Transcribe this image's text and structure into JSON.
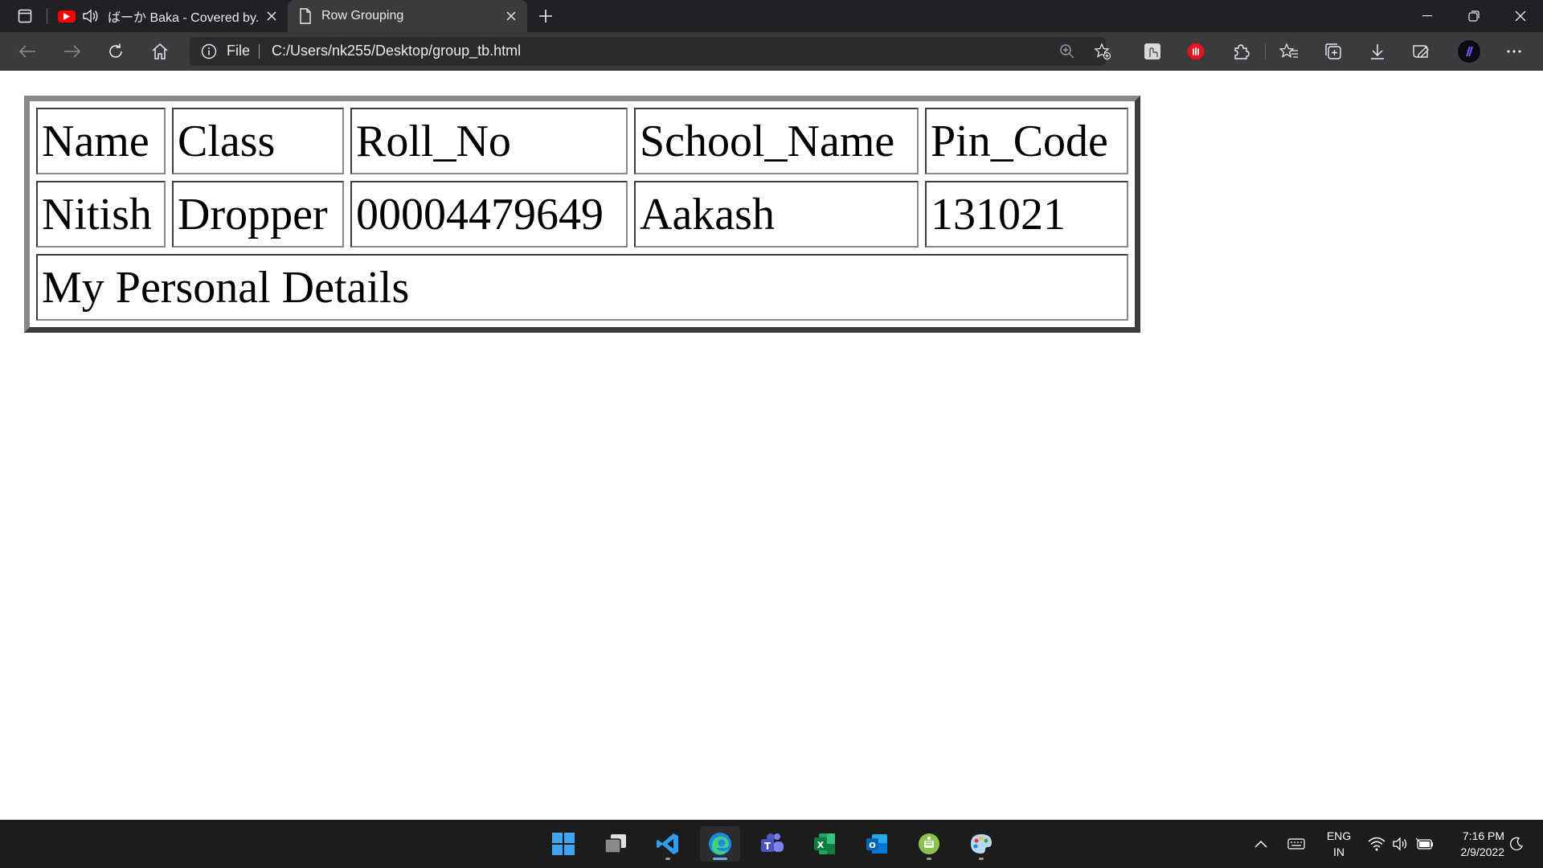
{
  "browser": {
    "tabs": [
      {
        "title": "ばーか Baka - Covered by. Ri",
        "icon": "youtube-icon",
        "playing_audio": true,
        "active": false
      },
      {
        "title": "Row Grouping",
        "icon": "file-icon",
        "active": true
      }
    ],
    "address": {
      "scheme_label": "File",
      "url": "C:/Users/nk255/Desktop/group_tb.html"
    }
  },
  "page": {
    "table": {
      "headers": [
        "Name",
        "Class",
        "Roll_No",
        "School_Name",
        "Pin_Code"
      ],
      "row": [
        "Nitish",
        "Dropper",
        "00004479649",
        "Aakash",
        "131021"
      ],
      "footer": "My Personal Details"
    }
  },
  "taskbar": {
    "apps": [
      "start",
      "task-view",
      "vscode",
      "edge",
      "teams",
      "excel",
      "outlook",
      "android-studio",
      "paint"
    ],
    "tray": {
      "lang_line1": "ENG",
      "lang_line2": "IN",
      "time": "7:16 PM",
      "date": "2/9/2022"
    }
  },
  "colors": {
    "tabbar_bg": "#202124",
    "toolbar_bg": "#3b3b3d",
    "taskbar_bg": "#1c1c1c",
    "edge_accent": "#5fb2f2"
  }
}
